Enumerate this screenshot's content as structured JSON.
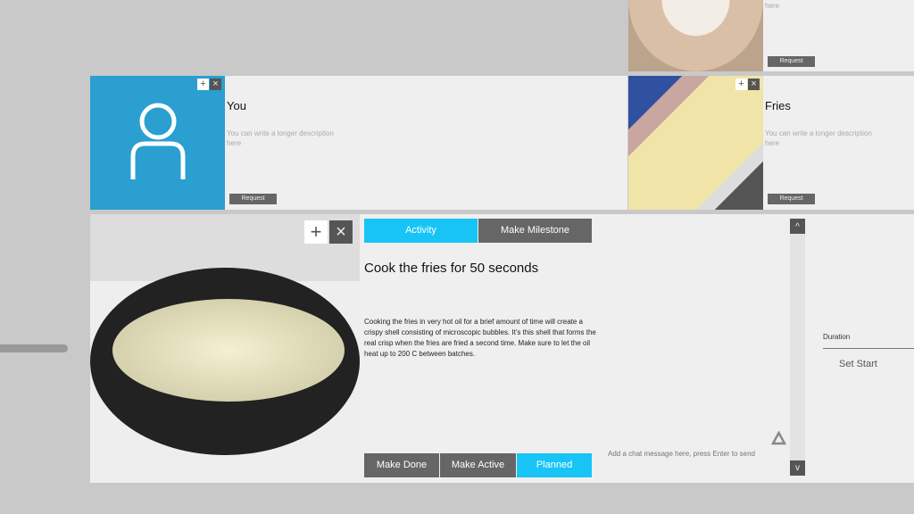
{
  "top_card": {
    "desc_tail": "here",
    "request": "Request"
  },
  "you_card": {
    "title": "You",
    "desc": "You can write a longer description here",
    "request": "Request",
    "avatar_color": "#2a9fd0"
  },
  "fries_card": {
    "title": "Fries",
    "desc": "You can write a longer description here",
    "request": "Request"
  },
  "main": {
    "tabs": [
      {
        "label": "Activity",
        "active": true
      },
      {
        "label": "Make Milestone",
        "active": false
      }
    ],
    "title": "Cook the fries for 50 seconds",
    "description": "Cooking the fries in very hot oil for a brief amount of time will create a crispy shell consisting of microscopic bubbles. It's this shell that forms the real crisp when the fries are fried a second time. Make sure to let the oil heat up to 200 C between batches.",
    "status_buttons": [
      {
        "label": "Make Done"
      },
      {
        "label": "Make Active"
      },
      {
        "label": "Planned",
        "active": true
      }
    ],
    "chat_placeholder": "Add a chat message here, press Enter to send",
    "scroll_up": "^",
    "scroll_down": "v",
    "duration_label": "Duration",
    "set_start": "Set Start",
    "accent": "#17c4f5"
  }
}
